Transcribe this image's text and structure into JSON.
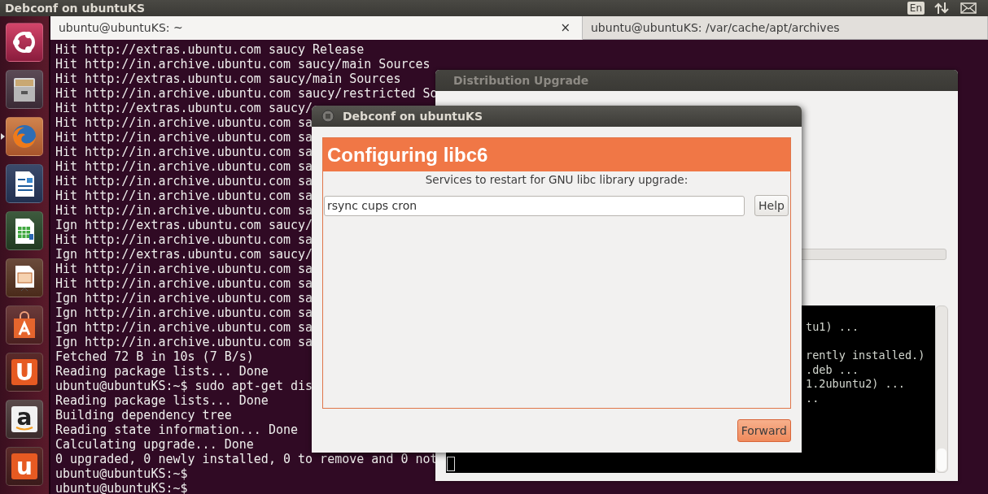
{
  "top_bar": {
    "title": "Debconf on ubuntuKS",
    "keyboard_layout": "En"
  },
  "launcher": {
    "items": [
      {
        "kind": "ubuntu",
        "running": false
      },
      {
        "kind": "files",
        "running": false
      },
      {
        "kind": "browser",
        "running": true
      },
      {
        "kind": "writer",
        "running": false
      },
      {
        "kind": "calc",
        "running": false
      },
      {
        "kind": "impress",
        "running": false
      },
      {
        "kind": "store",
        "running": false
      },
      {
        "kind": "glyph",
        "glyph": "U",
        "running": false
      },
      {
        "kind": "amazon",
        "glyph": "a",
        "running": false
      },
      {
        "kind": "glyph",
        "glyph": "u",
        "running": false
      }
    ]
  },
  "terminal": {
    "tabs": [
      {
        "label": "ubuntu@ubuntuKS: ~",
        "selected": true,
        "close": "×"
      },
      {
        "label": "ubuntu@ubuntuKS: /var/cache/apt/archives",
        "selected": false
      }
    ],
    "lines": [
      "Hit http://extras.ubuntu.com saucy Release",
      "Hit http://in.archive.ubuntu.com saucy/main Sources",
      "Hit http://extras.ubuntu.com saucy/main Sources",
      "Hit http://in.archive.ubuntu.com saucy/restricted So",
      "Hit http://extras.ubuntu.com saucy/",
      "Hit http://in.archive.ubuntu.com sa",
      "Hit http://in.archive.ubuntu.com sa",
      "Hit http://in.archive.ubuntu.com sa",
      "Hit http://in.archive.ubuntu.com sa",
      "Hit http://in.archive.ubuntu.com sa",
      "Hit http://in.archive.ubuntu.com sa",
      "Hit http://in.archive.ubuntu.com sa",
      "Ign http://extras.ubuntu.com saucy/",
      "Hit http://in.archive.ubuntu.com sa",
      "Ign http://extras.ubuntu.com saucy/",
      "Hit http://in.archive.ubuntu.com sa",
      "Hit http://in.archive.ubuntu.com sa",
      "Ign http://in.archive.ubuntu.com sa",
      "Ign http://in.archive.ubuntu.com sa",
      "Ign http://in.archive.ubuntu.com sa",
      "Ign http://in.archive.ubuntu.com sa",
      "Fetched 72 B in 10s (7 B/s)",
      "Reading package lists... Done",
      "ubuntu@ubuntuKS:~$ sudo apt-get dis",
      "Reading package lists... Done",
      "Building dependency tree",
      "Reading state information... Done",
      "Calculating upgrade... Done",
      "0 upgraded, 0 newly installed, 0 to remove and 0 not",
      "ubuntu@ubuntuKS:~$",
      "ubuntu@ubuntuKS:~$"
    ]
  },
  "distribution_upgrade": {
    "title": "Distribution Upgrade",
    "progress": {
      "level": 0
    },
    "terminal_lines": [
      "tu1) ...",
      "rently installed.)",
      ".deb ...",
      "1.2ubuntu2) ...",
      ".."
    ]
  },
  "debconf": {
    "title": "Debconf on ubuntuKS",
    "heading": "Configuring libc6",
    "prompt": "Services to restart for GNU libc library upgrade:",
    "value": "rsync cups cron",
    "help_button": "Help",
    "forward_button": "Forward"
  }
}
